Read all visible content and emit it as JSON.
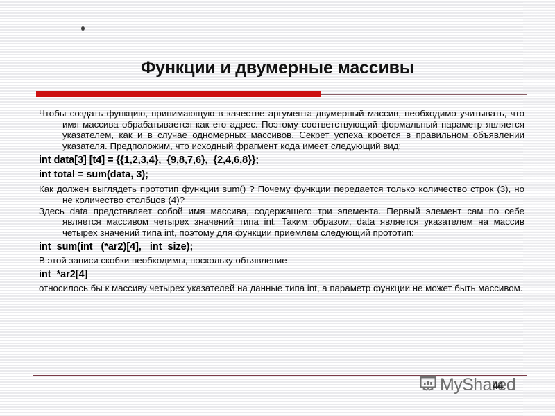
{
  "slide": {
    "title": "Функции и двумерные массивы",
    "accent_color": "#cc1111",
    "rule_color": "#7a3b47",
    "background": "#ffffff",
    "text_color": "#0d0d0d"
  },
  "content": {
    "paragraph_1": "Чтобы создать функцию, принимающую в качестве аргумента двумерный массив, необходимо учитывать, что имя массива обрабатывается как его адрес. Поэтому соответствующий формальный параметр является указателем, как и в случае одномерных массивов. Секрет успеха кроется в правильном объявлении указателя. Предположим, что исходный фрагмент кода имеет следующий вид:",
    "code_1": "int data[3] [t4] = {{1,2,3,4},  {9,8,7,6},  {2,4,6,8}};",
    "code_2": "int total = sum(data, 3);",
    "paragraph_2": "Как должен выглядеть прототип функции sum() ? Почему функции передается только количество строк (3), но не количество столбцов (4)?",
    "paragraph_3": "Здесь data представляет собой имя массива, содержащего три элемента. Первый элемент сам по себе является массивом четырех значений типа int. Таким образом, data является указателем на массив четырех значений типа int, поэтому для функции приемлем следующий прототип:",
    "code_3": "int  sum(int   (*ar2)[4],   int  size);",
    "paragraph_4": "В этой записи скобки необходимы, поскольку объявление",
    "code_4": "int  *ar2[4]",
    "paragraph_5": "относилось бы к массиву четырех указателей на данные типа int, а параметр функции не может быть массивом."
  },
  "footer": {
    "watermark_text": "MyShared",
    "watermark_icon": "presentation-chart-icon",
    "page_number": "44"
  }
}
